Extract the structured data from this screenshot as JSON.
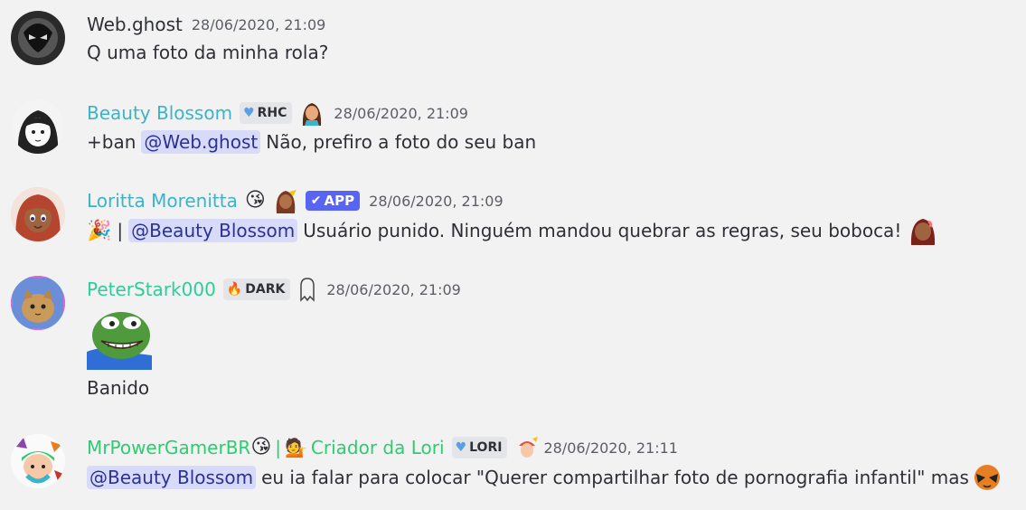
{
  "messages": [
    {
      "username": "Web.ghost",
      "username_color": "#2e3035",
      "timestamp": "28/06/2020, 21:09",
      "text": "Q uma foto da minha rola?"
    },
    {
      "username": "Beauty Blossom",
      "username_color": "#3bb3c8",
      "tag": {
        "icon": "blue-heart-icon",
        "label": "RHC"
      },
      "timestamp": "28/06/2020, 21:09",
      "text_prefix": "+ban",
      "mention": "@Web.ghost",
      "text": "Não, prefiro a foto do seu ban"
    },
    {
      "username": "Loritta Morenitta",
      "username_color": "#3bb3c8",
      "app_tag": "APP",
      "timestamp": "28/06/2020, 21:09",
      "separator": "|",
      "mention": "@Beauty Blossom",
      "text": "Usuário punido. Ninguém mandou quebrar as regras, seu boboca!"
    },
    {
      "username": "PeterStark000",
      "username_color": "#2ecc9b",
      "tag": {
        "icon": "fire-icon",
        "label": "DARK"
      },
      "timestamp": "28/06/2020, 21:09",
      "text": "Banido"
    },
    {
      "username": "MrPowerGamerBR",
      "username_color": "#2ecc71",
      "separator": "|",
      "title": "Criador da Lori",
      "tag": {
        "icon": "blue-heart-icon",
        "label": "LORI"
      },
      "timestamp": "28/06/2020, 21:11",
      "mention": "@Beauty Blossom",
      "text": "eu ia falar para colocar \"Querer compartilhar foto de pornografia infantil\" mas"
    }
  ],
  "colors": {
    "background": "#f2f2f3",
    "mention_bg": "#d8daf9",
    "mention_text": "#2c3293",
    "app_tag_bg": "#5865f2",
    "timestamp": "#5c5e66"
  }
}
